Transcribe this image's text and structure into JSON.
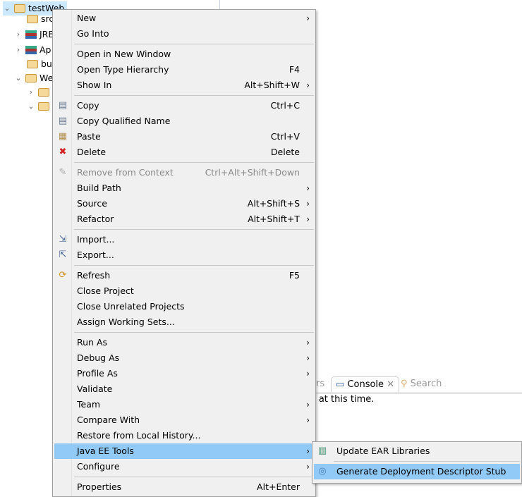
{
  "tree": {
    "items": [
      {
        "label": "testWeb",
        "twisty": "expanded",
        "icon": "web-project-icon",
        "selected": true
      },
      {
        "label": "src",
        "icon": "package-folder-icon"
      },
      {
        "label": "JRE",
        "twisty": "collapsed",
        "icon": "library-icon"
      },
      {
        "label": "Ap",
        "twisty": "collapsed",
        "icon": "library-icon"
      },
      {
        "label": "bu",
        "icon": "folder-icon"
      },
      {
        "label": "We",
        "twisty": "expanded",
        "icon": "folder-icon"
      },
      {
        "label": "",
        "twisty": "collapsed",
        "icon": "folder-icon"
      },
      {
        "label": "",
        "twisty": "expanded",
        "icon": "folder-icon"
      }
    ]
  },
  "console": {
    "tab_partial": "ers",
    "tab_console": "Console",
    "tab_search": "Search",
    "message": "y at this time."
  },
  "menu": {
    "items": [
      {
        "label": "New",
        "submenu": true
      },
      {
        "label": "Go Into"
      },
      {
        "sep": true
      },
      {
        "label": "Open in New Window"
      },
      {
        "label": "Open Type Hierarchy",
        "accel": "F4"
      },
      {
        "label": "Show In",
        "accel": "Alt+Shift+W",
        "submenu": true
      },
      {
        "sep": true
      },
      {
        "label": "Copy",
        "accel": "Ctrl+C",
        "icon": "copy-icon"
      },
      {
        "label": "Copy Qualified Name",
        "icon": "copy-qualified-icon"
      },
      {
        "label": "Paste",
        "accel": "Ctrl+V",
        "icon": "paste-icon"
      },
      {
        "label": "Delete",
        "accel": "Delete",
        "icon": "delete-icon"
      },
      {
        "sep": true
      },
      {
        "label": "Remove from Context",
        "accel": "Ctrl+Alt+Shift+Down",
        "icon": "remove-context-icon",
        "disabled": true
      },
      {
        "label": "Build Path",
        "submenu": true
      },
      {
        "label": "Source",
        "accel": "Alt+Shift+S",
        "submenu": true
      },
      {
        "label": "Refactor",
        "accel": "Alt+Shift+T",
        "submenu": true
      },
      {
        "sep": true
      },
      {
        "label": "Import...",
        "icon": "import-icon"
      },
      {
        "label": "Export...",
        "icon": "export-icon"
      },
      {
        "sep": true
      },
      {
        "label": "Refresh",
        "accel": "F5",
        "icon": "refresh-icon"
      },
      {
        "label": "Close Project"
      },
      {
        "label": "Close Unrelated Projects"
      },
      {
        "label": "Assign Working Sets..."
      },
      {
        "sep": true
      },
      {
        "label": "Run As",
        "submenu": true
      },
      {
        "label": "Debug As",
        "submenu": true
      },
      {
        "label": "Profile As",
        "submenu": true
      },
      {
        "label": "Validate"
      },
      {
        "label": "Team",
        "submenu": true
      },
      {
        "label": "Compare With",
        "submenu": true
      },
      {
        "label": "Restore from Local History..."
      },
      {
        "label": "Java EE Tools",
        "submenu": true,
        "highlighted": true
      },
      {
        "label": "Configure",
        "submenu": true
      },
      {
        "sep": true
      },
      {
        "label": "Properties",
        "accel": "Alt+Enter"
      }
    ]
  },
  "submenu": {
    "items": [
      {
        "label": "Update EAR Libraries",
        "icon": "library-icon"
      },
      {
        "label": "Generate Deployment Descriptor Stub",
        "icon": "descriptor-icon",
        "highlighted": true
      }
    ]
  },
  "colors": {
    "highlight": "#91c9f7",
    "menu_bg": "#f0f0f0",
    "selection": "#cce8ff"
  }
}
